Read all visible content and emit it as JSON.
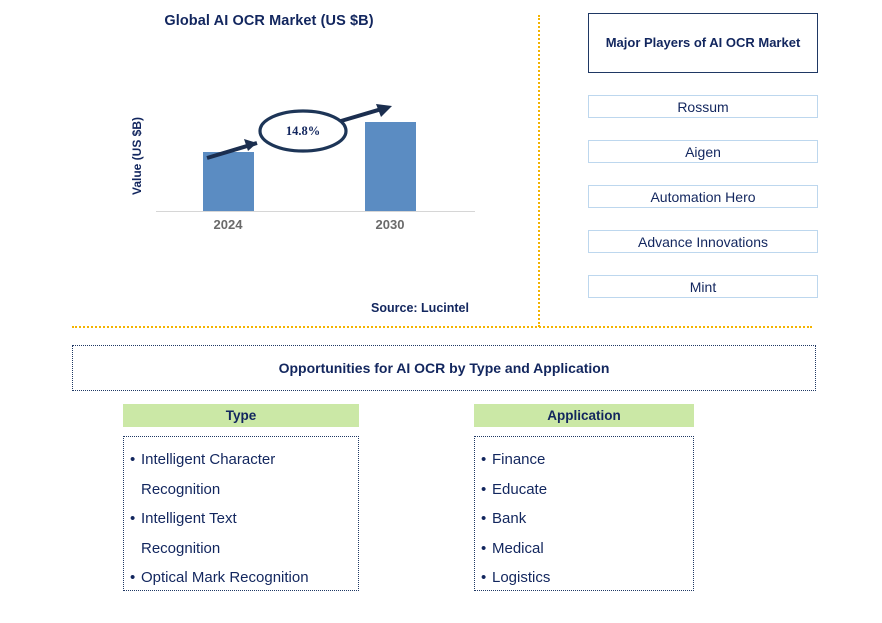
{
  "chart": {
    "title": "Global AI OCR Market (US $B)",
    "y_axis_label": "Value (US $B)",
    "cagr_label": "14.8%",
    "source": "Source: Lucintel"
  },
  "chart_data": {
    "type": "bar",
    "title": "Global AI OCR Market (US $B)",
    "xlabel": "",
    "ylabel": "Value (US $B)",
    "categories": [
      "2024",
      "2030"
    ],
    "values": [
      59,
      89
    ],
    "annotations": [
      {
        "text": "14.8%",
        "kind": "cagr-callout",
        "from": "2024",
        "to": "2030"
      }
    ],
    "grid": false,
    "legend": "none",
    "source": "Source: Lucintel",
    "bar_color": "#5b8cc2"
  },
  "players": {
    "header": "Major Players of AI OCR Market",
    "items": [
      {
        "label": "Rossum"
      },
      {
        "label": "Aigen"
      },
      {
        "label": "Automation Hero"
      },
      {
        "label": "Advance Innovations"
      },
      {
        "label": "Mint"
      }
    ]
  },
  "opportunities": {
    "banner": "Opportunities for AI OCR by Type and Application",
    "columns": [
      {
        "header": "Type",
        "items": [
          "Intelligent Character\nRecognition",
          "Intelligent Text\nRecognition",
          "Optical Mark Recognition"
        ]
      },
      {
        "header": "Application",
        "items": [
          "Finance",
          "Educate",
          "Bank",
          "Medical",
          "Logistics"
        ]
      }
    ]
  },
  "colors": {
    "navy": "#12265e",
    "bar": "#5b8cc2",
    "divider": "#f5b400",
    "header_green": "#cbe8a6",
    "player_border": "#bdd7ee"
  }
}
